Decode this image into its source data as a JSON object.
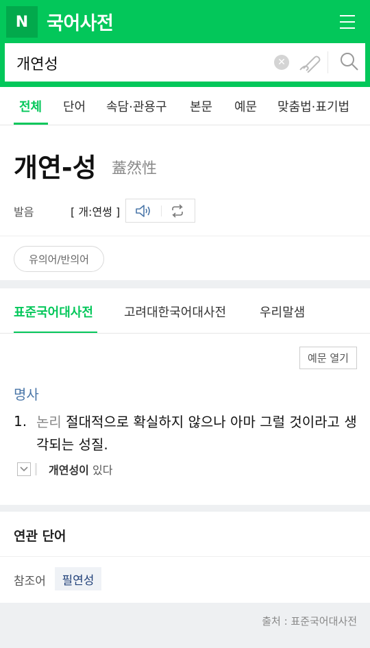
{
  "header": {
    "logo": "N",
    "title": "국어사전",
    "search_value": "개연성"
  },
  "tabs": [
    "전체",
    "단어",
    "속담·관용구",
    "본문",
    "예문",
    "맞춤법·표기법"
  ],
  "entry": {
    "word": "개연-성",
    "hanja": "蓋然性",
    "pron_label": "발음",
    "pron_value": "[ 개:연썽 ]",
    "chip": "유의어/반의어"
  },
  "dict_tabs": [
    "표준국어대사전",
    "고려대한국어대사전",
    "우리말샘"
  ],
  "definition": {
    "example_button": "예문 열기",
    "pos": "명사",
    "number": "1.",
    "tag": "논리",
    "text": " 절대적으로 확실하지 않으나 아마 그럴 것이라고 생각되는 성질.",
    "example_bold": "개연성이",
    "example_rest": " 있다"
  },
  "related": {
    "title": "연관 단어",
    "ref_label": "참조어",
    "ref_word": "필연성"
  },
  "footer": {
    "source": "출처 : 표준국어대사전"
  },
  "colors": {
    "brand": "#03c75a",
    "pos": "#4a76a8",
    "ref_word": "#1f3f78"
  }
}
